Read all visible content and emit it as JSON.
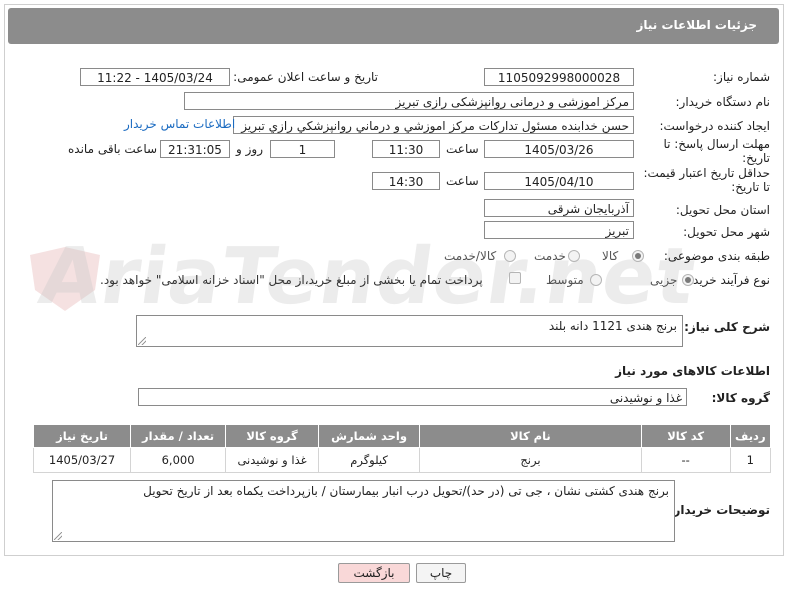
{
  "header": {
    "title": "جزئیات اطلاعات نیاز"
  },
  "labels": {
    "need_number": "شماره نیاز:",
    "announce_datetime": "تاریخ و ساعت اعلان عمومی:",
    "buyer_org": "نام دستگاه خریدار:",
    "requester": "ایجاد کننده درخواست:",
    "reply_deadline": "مهلت ارسال پاسخ: تا تاریخ:",
    "price_validity": "حداقل تاریخ اعتبار قیمت: تا تاریخ:",
    "delivery_province": "استان محل تحویل:",
    "delivery_city": "شهر محل تحویل:",
    "category": "طبقه بندی موضوعی:",
    "process_type": "نوع فرآیند خرید :",
    "time_word": "ساعت",
    "days_and": "روز و",
    "remaining": "ساعت باقی مانده",
    "description": "شرح کلی نیاز:",
    "goods_info": "اطلاعات کالاهای مورد نیاز",
    "goods_group": "گروه کالا:",
    "buyer_notes": "توضیحات خریدار:"
  },
  "fields": {
    "need_number": "1105092998000028",
    "announce_datetime": "1405/03/24 - 11:22",
    "buyer_org": "مرکز اموزشی و درمانی روانپزشکی رازی تبریز",
    "requester": "حسن خدابنده مسئول تداركات مركز اموزشي و درماني روانپزشكي رازي تبريز",
    "requester_link": "اطلاعات تماس خریدار",
    "reply_date": "1405/03/26",
    "reply_time": "11:30",
    "reply_days": "1",
    "reply_remaining": "21:31:05",
    "validity_date": "1405/04/10",
    "validity_time": "14:30",
    "delivery_province": "آذربایجان شرقی",
    "delivery_city": "تبریز",
    "description": "برنج هندی 1121 دانه بلند",
    "goods_group": "غذا و نوشیدنی",
    "buyer_notes": "برنج هندی کشتی نشان ، جی تی (در حد)/تحویل درب انبار بیمارستان / بازپرداخت یکماه بعد از تاریخ تحویل"
  },
  "category_options": [
    {
      "label": "کالا",
      "checked": true
    },
    {
      "label": "خدمت",
      "checked": false
    },
    {
      "label": "کالا/خدمت",
      "checked": false
    }
  ],
  "process_options": [
    {
      "label": "جزیی",
      "checked": true
    },
    {
      "label": "متوسط",
      "checked": false
    }
  ],
  "process_note": "پرداخت تمام یا بخشی از مبلغ خرید،از محل \"اسناد خزانه اسلامی\" خواهد بود.",
  "table": {
    "headers": [
      "ردیف",
      "کد کالا",
      "نام کالا",
      "واحد شمارش",
      "گروه کالا",
      "تعداد / مقدار",
      "تاریخ نیاز"
    ],
    "rows": [
      [
        "1",
        "--",
        "برنج",
        "کیلوگرم",
        "غذا و نوشیدنی",
        "6,000",
        "1405/03/27"
      ]
    ]
  },
  "buttons": {
    "print": "چاپ",
    "back": "بازگشت"
  },
  "watermark": "AriaTender.net",
  "colors": {
    "header_bg": "#8c8c8c",
    "link": "#1b6bc1",
    "back_btn_bg": "#f9d8d8"
  }
}
